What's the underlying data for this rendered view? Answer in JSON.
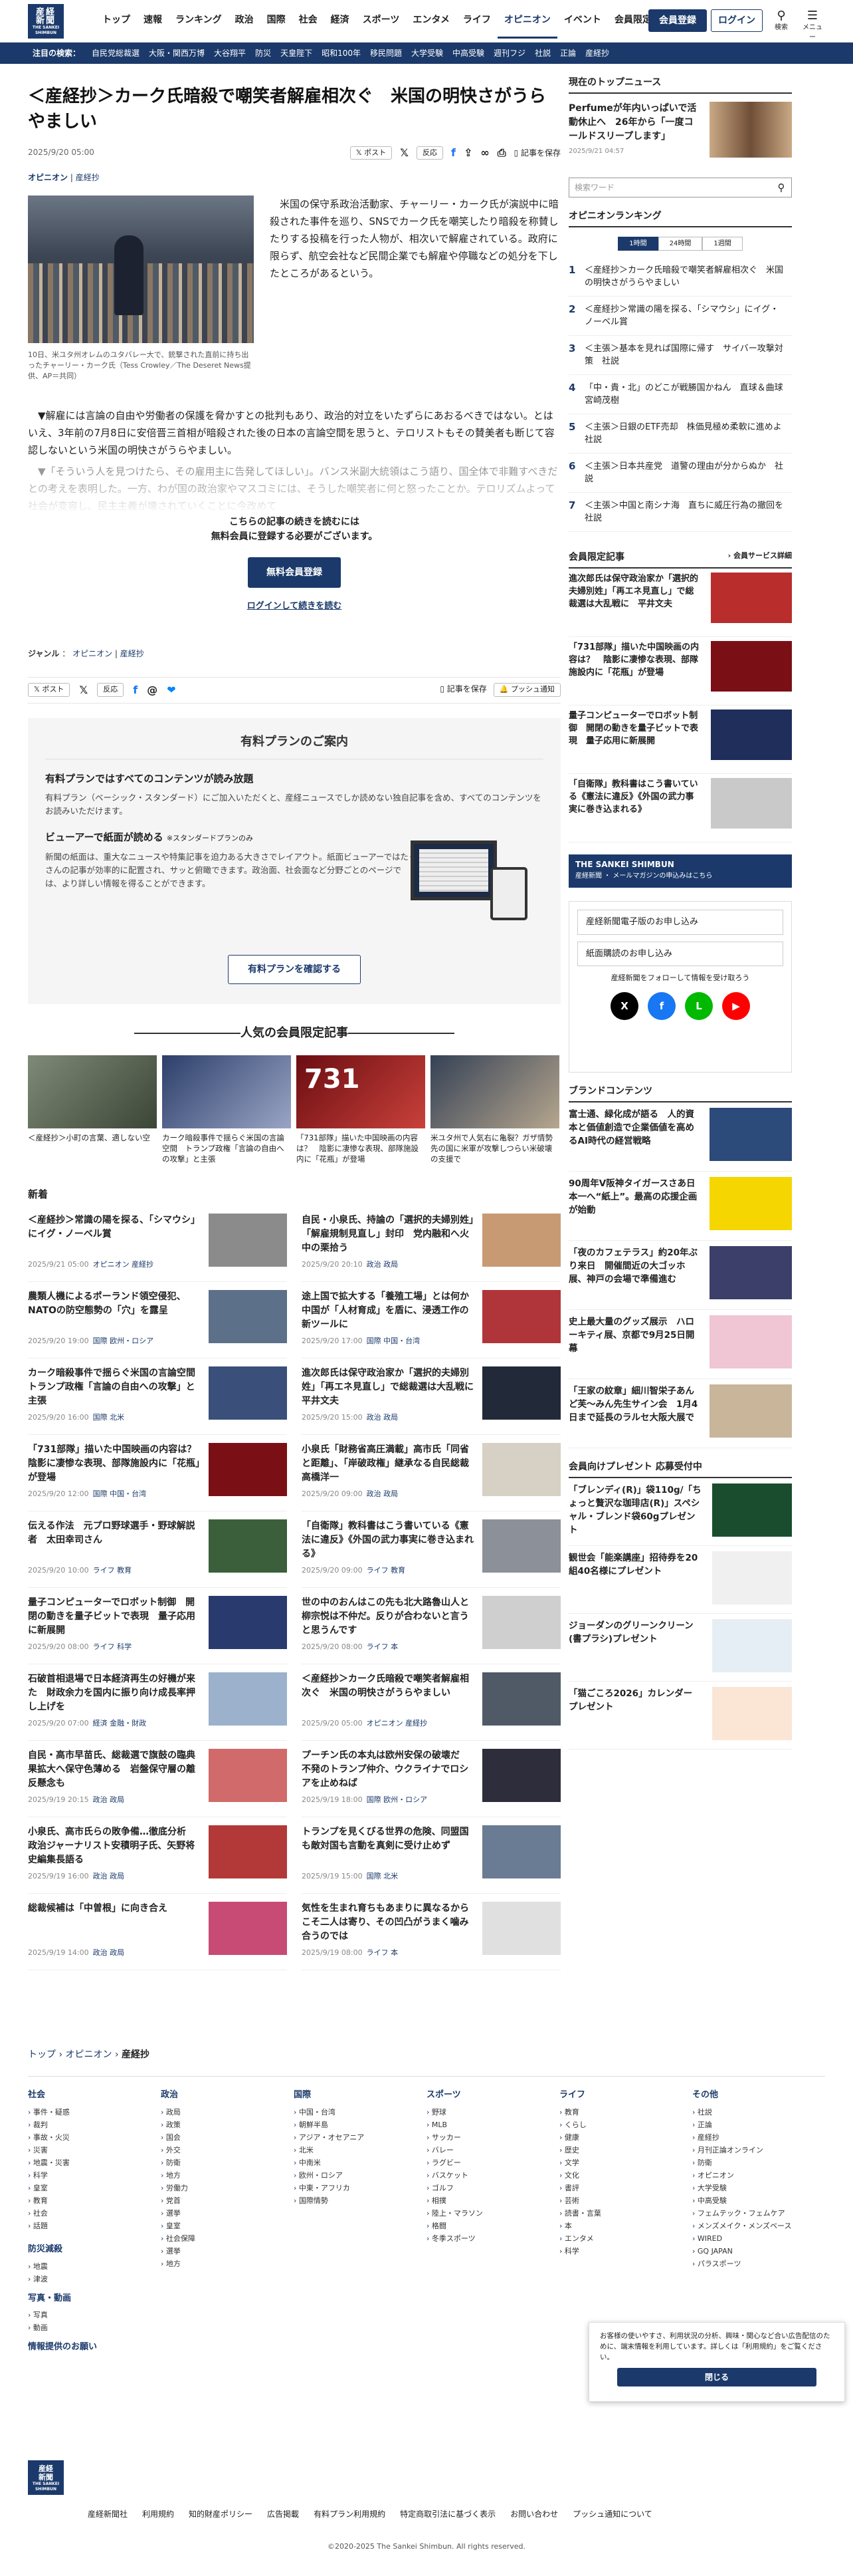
{
  "brand": {
    "logo": "産経新聞",
    "logo_en": "THE SANKEI SHIMBUN"
  },
  "nav": [
    "トップ",
    "速報",
    "ランキング",
    "政治",
    "国際",
    "社会",
    "経済",
    "スポーツ",
    "エンタメ",
    "ライフ",
    "オピニオン",
    "イベント",
    "会員限定記事"
  ],
  "nav_current": "オピニオン",
  "header": {
    "register": "会員登録",
    "login": "ログイン",
    "search": "検索",
    "menu": "メニュー"
  },
  "subnav": {
    "label": "注目の検索：",
    "items": [
      "自民党総裁選",
      "大阪・関西万博",
      "大谷翔平",
      "防災",
      "天皇陛下",
      "昭和100年",
      "移民問題",
      "大学受験",
      "中高受験",
      "週刊フジ",
      "社説",
      "正論",
      "産経抄"
    ]
  },
  "article": {
    "title": "＜産経抄＞カーク氏暗殺で嘲笑者解雇相次ぐ　米国の明快さがうらやましい",
    "date": "2025/9/20 05:00",
    "category": "オピニオン",
    "category2": "産経抄",
    "share_post": "ポスト",
    "share_react": "反応",
    "save": "記事を保存",
    "caption": "10日、米ユタ州オレムのユタバレー大で、銃撃された直前に持ち出ったチャーリー・カーク氏（Tess Crowley／The Deseret News提供、AP＝共同）",
    "p1": "米国の保守系政治活動家、チャーリー・カーク氏が演説中に暗殺された事件を巡り、SNSでカーク氏を嘲笑したり暗殺を称賛したりする投稿を行った人物が、相次いで解雇されている。政府に限らず、航空会社など民間企業でも解雇や停職などの処分を下したところがあるという。",
    "p2": "▼解雇には言論の自由や労働者の保護を脅かすとの批判もあり、政治的対立をいたずらにあおるべきではない。とはいえ、3年前の7月8日に安倍晋三首相が暗殺された後の日本の言論空間を思うと、テロリストもその賛美者も断じて容認しないという米国の明快さがうらやましい。",
    "fade": "▼「そういう人を見つけたら、その雇用主に告発してほしい」。バンス米副大統領はこう語り、国全体で非難すべきだとの考えを表明した。一方、わが国の政治家やマスコミには、そうした嘲笑者に何と怒ったことか。テロリズムよって社会が変容し、民主主義が壊されていくことに今改めて"
  },
  "paywall": {
    "line1": "こちらの記事の続きを読むには",
    "line2": "無料会員に登録する必要がございます。",
    "button": "無料会員登録",
    "login": "ログインして続きを読む"
  },
  "genre": {
    "label": "ジャンル",
    "sep": "：",
    "items": [
      "オピニオン",
      "産経抄"
    ]
  },
  "share2": {
    "post": "ポスト",
    "react": "反応",
    "save": "記事を保存",
    "push": "プッシュ通知"
  },
  "plan": {
    "title": "有料プランのご案内",
    "h1": "有料プランではすべてのコンテンツが読み放題",
    "t1": "有料プラン（ベーシック・スタンダード）にご加入いただくと、産経ニュースでしか読めない独自記事を含め、すべてのコンテンツをお読みいただけます。",
    "h2": "ビューアーで紙面が読める",
    "h2note": "※スタンダードプランのみ",
    "t2": "新聞の紙面は、重大なニュースや特集記事を迫力ある大きさでレイアウト。紙面ビューアーではたくさんの記事が効率的に配置され、サッと俯瞰できます。政治面、社会面など分野ごとのページでは、より詳しい情報を得ることができます。",
    "button": "有料プランを確認する"
  },
  "popular": {
    "title": "人気の会員限定記事",
    "items": [
      "＜産経抄＞小町の言葉、適しない空",
      "カーク暗殺事件で揺らぐ米国の言論空間　トランプ政権「言論の自由への攻撃」と主張",
      "「731部隊」描いた中国映画の内容は？　陰影に凄惨な表現、部隊施設内に「花瓶」が登場",
      "米ユタ州で人気右に亀裂？ガザ情勢先の国に米軍が攻撃しつらい米破壊の支援で"
    ]
  },
  "new": {
    "title": "新着",
    "items": [
      {
        "t": "＜産経抄＞常識の陽を探る、「シマウシ」にイグ・ノーベル賞",
        "d": "2025/9/21 05:00",
        "g": "オピニオン 産経抄"
      },
      {
        "t": "自民・小泉氏、持論の「選択的夫婦別姓」「解雇規制見直し」封印　党内融和へ火中の栗拾う",
        "d": "2025/9/20 20:10",
        "g": "政治 政局"
      },
      {
        "t": "農類人機によるポーランド領空侵犯、NATOの防空態勢の「穴」を露呈",
        "d": "2025/9/20 19:00",
        "g": "国際 欧州・ロシア"
      },
      {
        "t": "途上国で拡大する「養殖工場」とは何か　中国が「人材育成」を盾に、浸透工作の新ツールに",
        "d": "2025/9/20 17:00",
        "g": "国際 中国・台湾"
      },
      {
        "t": "カーク暗殺事件で揺らぐ米国の言論空間　トランプ政権「言論の自由への攻撃」と主張",
        "d": "2025/9/20 16:00",
        "g": "国際 北米"
      },
      {
        "t": "進次郎氏は保守政治家か「選択的夫婦別姓」「再エネ見直し」で総裁選は大乱戦に　平井文夫",
        "d": "2025/9/20 15:00",
        "g": "政治 政局"
      },
      {
        "t": "「731部隊」描いた中国映画の内容は？　陰影に凄惨な表現、部隊施設内に「花瓶」が登場",
        "d": "2025/9/20 12:00",
        "g": "国際 中国・台湾"
      },
      {
        "t": "小泉氏「財務省高圧満載」高市氏「同省と距離」、「岸破政権」継承なる自民総裁　高橋洋一",
        "d": "2025/9/20 09:00",
        "g": "政治 政局"
      },
      {
        "t": "伝える作法　元プロ野球選手・野球解説者　太田幸司さん",
        "d": "2025/9/20 10:00",
        "g": "ライフ 教育"
      },
      {
        "t": "「自衛隊」教科書はこう書いている《憲法に違反》《外国の武力事実に巻き込まれる》",
        "d": "2025/9/20 09:00",
        "g": "ライフ 教育"
      },
      {
        "t": "量子コンピューターでロボット制御　開閉の動きを量子ビットで表現　量子応用に新展開",
        "d": "2025/9/20 08:00",
        "g": "ライフ 科学"
      },
      {
        "t": "世の中のおんはこの先も北大路魯山人と柳宗悦は不仲だ。反りが合わないと言うと思うんです",
        "d": "2025/9/20 08:00",
        "g": "ライフ 本"
      },
      {
        "t": "石破首相退場で日本経済再生の好機が来た　財政余力を国内に振り向け成長率押し上げを",
        "d": "2025/9/20 07:00",
        "g": "経済 金融・財政"
      },
      {
        "t": "＜産経抄＞カーク氏暗殺で嘲笑者解雇相次ぐ　米国の明快さがうらやましい",
        "d": "2025/9/20 05:00",
        "g": "オピニオン 産経抄"
      },
      {
        "t": "自民・高市早苗氏、総裁選で旗鼓の臨典果拡大へ保守色薄める　岩盤保守層の離反懸念も",
        "d": "2025/9/19 20:15",
        "g": "政治 政局"
      },
      {
        "t": "プーチン氏の本丸は欧州安保の破壊だ　不発のトランプ仲介、ウクライナでロシアを止めねば",
        "d": "2025/9/19 18:00",
        "g": "国際 欧州・ロシア"
      },
      {
        "t": "小泉氏、高市氏らの敗争備…徹底分析　政治ジャーナリスト安積明子氏、矢野将史編集長語る",
        "d": "2025/9/19 16:00",
        "g": "政治 政局"
      },
      {
        "t": "トランプを見くびる世界の危険、同盟国も敵対国も言動を真剣に受け止めず",
        "d": "2025/9/19 15:00",
        "g": "国際 北米"
      },
      {
        "t": "総裁候補は「中曽根」に向き合え",
        "d": "2025/9/19 14:00",
        "g": "政治 政局"
      },
      {
        "t": "気性を生まれ育ちもあまりに異なるからこそ二人は寄り、その凹凸がうまく噛み合うのでは",
        "d": "2025/9/19 08:00",
        "g": "ライフ 本"
      }
    ]
  },
  "side": {
    "top_title": "現在のトップニュース",
    "top": {
      "t": "Perfumeが年内いっぱいで活動休止へ　26年から「一度コールドスリープします」",
      "d": "2025/9/21 04:57"
    },
    "search_placeholder": "検索ワード",
    "rank_title": "オピニオンランキング",
    "tabs": [
      "1時間",
      "24時間",
      "1週間"
    ],
    "rank": [
      "＜産経抄＞カーク氏暗殺で嘲笑者解雇相次ぐ　米国の明快さがうらやましい",
      "＜産経抄＞常識の陽を探る、「シマウシ」にイグ・ノーベル賞",
      "＜主張＞基本を見れば国際に帰す　サイバー攻撃対策　社説",
      "「中・貴・北」のどこが戦勝国かねん　直球＆曲球　宮崎茂樹",
      "＜主張＞日銀のETF売却　株価見極め柔軟に進めよ　社説",
      "＜主張＞日本共産党　道警の理由が分からぬか　社説",
      "＜主張＞中国と南シナ海　直ちに威圧行為の撤回を　社説"
    ],
    "member_title": "会員限定記事",
    "member_more": "会員サービス詳細",
    "member": [
      "進次郎氏は保守政治家か「選択的夫婦別姓」「再エネ見直し」で総裁選は大乱戦に　平井文夫",
      "「731部隊」描いた中国映画の内容は？　陰影に凄惨な表現、部隊施設内に「花瓶」が登場",
      "量子コンピューターでロボット制御　開閉の動きを量子ビットで表現　量子応用に新展開",
      "「自衛隊」教科書はこう書いている《憲法に違反》《外国の武力事実に巻き込まれる》"
    ],
    "banner": "THE SANKEI SHIMBUN",
    "banner_sub": "産経新聞 ・ メールマガジンの申込みはこちら",
    "links": [
      "産経新聞電子版のお申し込み",
      "紙面購読のお申し込み"
    ],
    "follow": "産経新聞をフォローして情報を受け取ろう",
    "sns": [
      "X",
      "f",
      "L",
      "▶"
    ],
    "brand_title": "ブランドコンテンツ",
    "brand": [
      "富士通、緑化成が語る　人的資本と価値創造で企業価値を高めるAI時代の経営戦略",
      "90周年V阪神タイガースさあ日本一へ“紙上”。最高の応援企画が始動",
      "「夜のカフェテラス」約20年ぶり来日　開催間近の大ゴッホ展、神戸の会場で準備進む",
      "史上最大量のグッズ展示　ハローキティ展、京都で9月25日開幕",
      "「王家の紋章」細川智栄子あんど芙～みん先生サイン会　1月4日まで延長のラルセ大阪大展で"
    ],
    "present_title": "会員向けプレゼント 応募受付中",
    "present": [
      "「ブレンディ(R)」袋110g/「ちょっと贅沢な珈琲店(R)」スペシャル・ブレンド袋60gプレゼント",
      "観世会「能楽講座」招待券を20組40名様にプレゼント",
      "ジョーダンのグリーンクリーン(書プラシ)プレゼント",
      "「猫ごころ2026」カレンダー　プレゼント"
    ]
  },
  "breadcrumb": [
    "トップ",
    "オピニオン",
    "産経抄"
  ],
  "footnav": [
    {
      "h": "社会",
      "items": [
        "事件・疑惑",
        "裁判",
        "事故・火災",
        "災害",
        "地震・災害",
        "科学",
        "皇室",
        "教育",
        "社会",
        "話題"
      ]
    },
    {
      "h": "政治",
      "items": [
        "政局",
        "政策",
        "国会",
        "外交",
        "防衛",
        "地方",
        "労働力",
        "党首",
        "選挙",
        "皇室",
        "社会保障",
        "選挙",
        "地方"
      ]
    },
    {
      "h": "国際",
      "items": [
        "中国・台湾",
        "朝鮮半島",
        "アジア・オセアニア",
        "北米",
        "中南米",
        "欧州・ロシア",
        "中東・アフリカ",
        "国際情勢"
      ]
    },
    {
      "h": "スポーツ",
      "items": [
        "野球",
        "MLB",
        "サッカー",
        "バレー",
        "ラグビー",
        "バスケット",
        "ゴルフ",
        "相撲",
        "陸上・マラソン",
        "格闘",
        "冬季スポーツ"
      ]
    },
    {
      "h": "ライフ",
      "items": [
        "教育",
        "くらし",
        "健康",
        "歴史",
        "文学",
        "文化",
        "書評",
        "芸術",
        "読書・言葉",
        "本",
        "エンタメ",
        "科学"
      ]
    },
    {
      "h": "その他",
      "items": [
        "社説",
        "正論",
        "産経抄",
        "月刊正論オンライン",
        "防衛",
        "オピニオン",
        "大学受験",
        "中高受験",
        "フェムテック・フェムケア",
        "メンズメイク・メンズベース",
        "WIRED",
        "GQ JAPAN",
        "パラスポーツ"
      ]
    }
  ],
  "footnav2": [
    {
      "h": "防災減殺",
      "items": [
        "地震",
        "津波"
      ]
    },
    {
      "h": "写真・動画",
      "items": [
        "写真",
        "動画"
      ]
    },
    {
      "h": "情報提供のお願い",
      "items": []
    }
  ],
  "cookie": {
    "text": "お客様の使いやすさ、利用状況の分析、興味・関心など合い広告配信のために、端末情報を利用しています。詳しくは「利用規約」をご覧ください。",
    "button": "閉じる"
  },
  "footer_links": [
    "産経新聞社",
    "利用規約",
    "知的財産ポリシー",
    "広告掲載",
    "有料プラン利用規約",
    "特定商取引法に基づく表示",
    "お問い合わせ",
    "プッシュ通知について"
  ],
  "copyright": "©2020-2025 The Sankei Shimbun. All rights reserved.",
  "colors": {
    "brand": "#1b3a6b",
    "line": "#00b900",
    "facebook": "#1877f2",
    "youtube": "#ff0000"
  }
}
